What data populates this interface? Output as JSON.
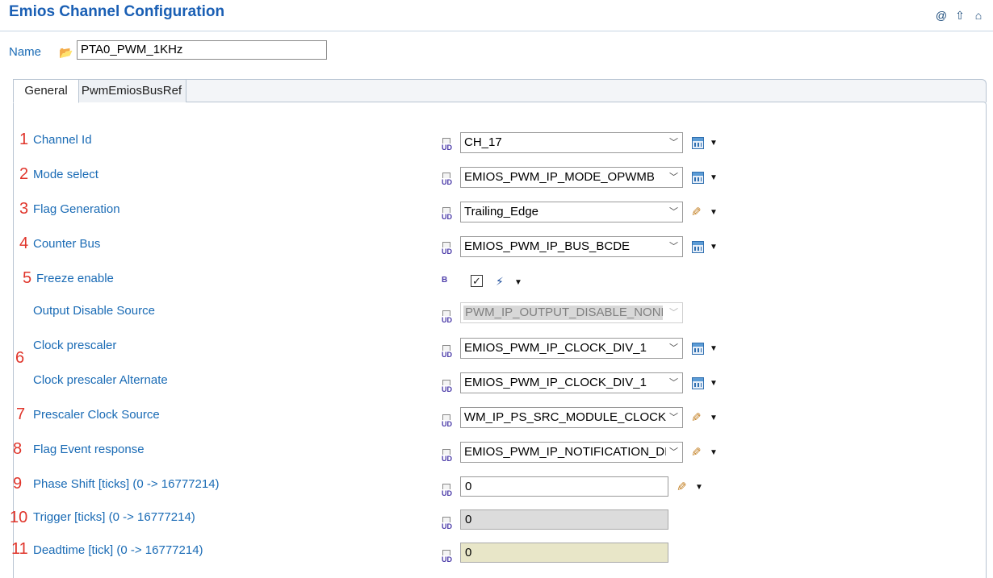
{
  "title": "Emios Channel Configuration",
  "header_icons": [
    "@",
    "⇧",
    "⌂"
  ],
  "name": {
    "label": "Name",
    "value": "PTA0_PWM_1KHz"
  },
  "tabs": [
    {
      "label": "General",
      "active": true
    },
    {
      "label": "PwmEmiosBusRef",
      "active": false
    }
  ],
  "rows": [
    {
      "num": "1",
      "label": "Channel Id",
      "value": "CH_17"
    },
    {
      "num": "2",
      "label": "Mode select",
      "value": "EMIOS_PWM_IP_MODE_OPWMB"
    },
    {
      "num": "3",
      "label": "Flag Generation",
      "value": "Trailing_Edge"
    },
    {
      "num": "4",
      "label": "Counter Bus",
      "value": "EMIOS_PWM_IP_BUS_BCDE"
    },
    {
      "num": "5",
      "label": "Freeze enable",
      "checked": "✓"
    },
    {
      "num": "",
      "label": "Output Disable Source",
      "value": "PWM_IP_OUTPUT_DISABLE_NONE"
    },
    {
      "num": "6",
      "label": "Clock prescaler",
      "value": "EMIOS_PWM_IP_CLOCK_DIV_1"
    },
    {
      "num": "",
      "label": "Clock prescaler Alternate",
      "value": "EMIOS_PWM_IP_CLOCK_DIV_1"
    },
    {
      "num": "7",
      "label": "Prescaler Clock Source",
      "value": "PWM_IP_PS_SRC_MODULE_CLOCK"
    },
    {
      "num": "8",
      "label": "Flag Event response",
      "value": "EMIOS_PWM_IP_NOTIFICATION_DI"
    },
    {
      "num": "9",
      "label": "Phase Shift [ticks] (0 -> 16777214)",
      "value": "0"
    },
    {
      "num": "10",
      "label": "Trigger [ticks] (0 -> 16777214)",
      "value": "0"
    },
    {
      "num": "11",
      "label": "Deadtime [tick] (0 -> 16777214)",
      "value": "0"
    }
  ],
  "icons": {
    "user_defined": "UD",
    "dropdown": "▼",
    "chevron": "﹀",
    "pencil": "✎",
    "wand": "⚡",
    "folder": "📂"
  },
  "colors": {
    "title": "#1a5fb4",
    "label": "#1a6bb5",
    "annotation": "#e0352b",
    "disabled_field": "#d8d8d8",
    "deadtime_field": "#e8e6c8"
  }
}
